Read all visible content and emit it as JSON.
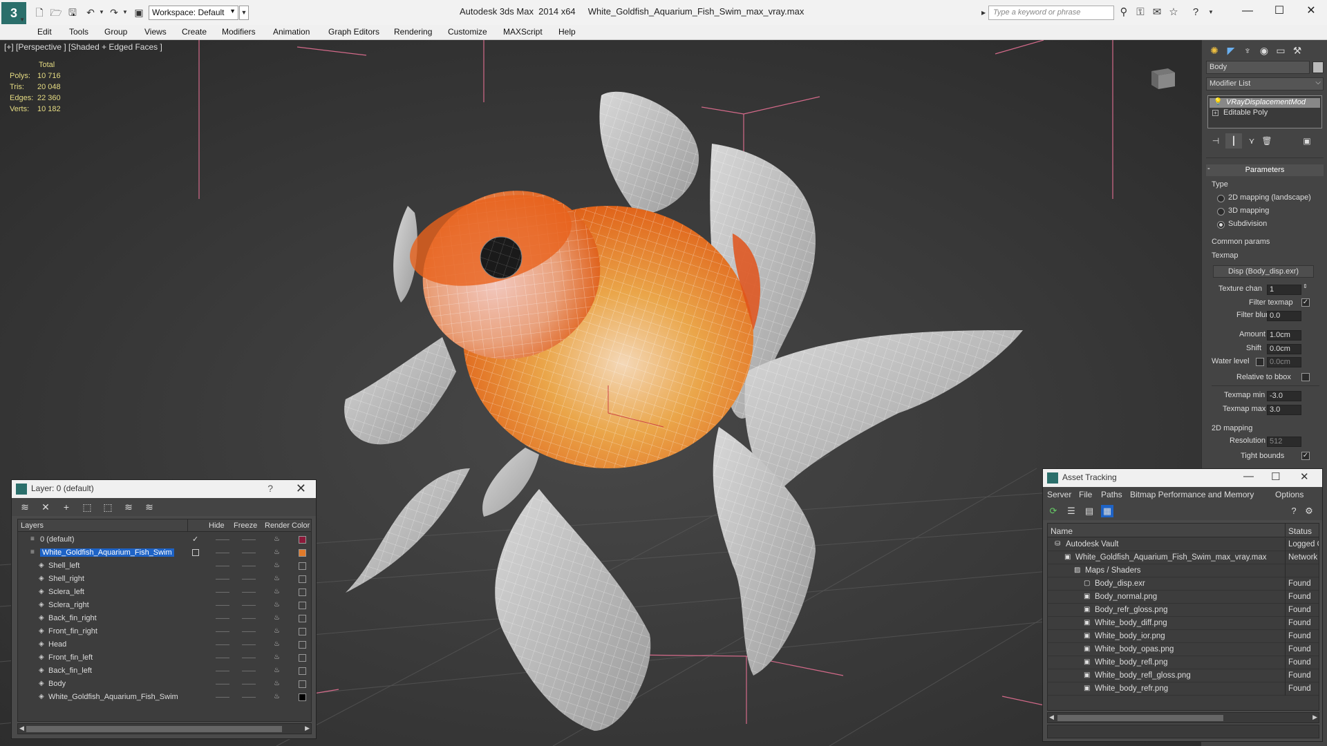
{
  "titlebar": {
    "app_title": "Autodesk 3ds Max  2014 x64",
    "file_title": "White_Goldfish_Aquarium_Fish_Swim_max_vray.max",
    "workspace": "Workspace: Default",
    "search_placeholder": "Type a keyword or phrase",
    "logo_letter": "3"
  },
  "menubar": {
    "items": [
      "Edit",
      "Tools",
      "Group",
      "Views",
      "Create",
      "Modifiers",
      "Animation",
      "Graph Editors",
      "Rendering",
      "Customize",
      "MAXScript",
      "Help"
    ]
  },
  "viewport": {
    "label": "[+] [Perspective ] [Shaded + Edged Faces ]",
    "stats_header": "Total",
    "stats": [
      {
        "key": "Polys:",
        "value": "10 716"
      },
      {
        "key": "Tris:",
        "value": "20 048"
      },
      {
        "key": "Edges:",
        "value": "22 360"
      },
      {
        "key": "Verts:",
        "value": "10 182"
      }
    ]
  },
  "command_panel": {
    "object_name": "Body",
    "modifier_list": "Modifier List",
    "stack": [
      "VRayDisplacementMod",
      "Editable Poly"
    ],
    "rollout_title": "Parameters",
    "type_label": "Type",
    "type_options": [
      "2D mapping (landscape)",
      "3D mapping",
      "Subdivision"
    ],
    "common_params": "Common params",
    "texmap_label": "Texmap",
    "texmap_button": "Disp (Body_disp.exr)",
    "texture_chan_label": "Texture chan",
    "texture_chan_value": "1",
    "filter_texmap_label": "Filter texmap",
    "filter_blur_label": "Filter blur",
    "filter_blur_value": "0.0",
    "amount_label": "Amount",
    "amount_value": "1.0cm",
    "shift_label": "Shift",
    "shift_value": "0.0cm",
    "water_level_label": "Water level",
    "water_level_value": "0.0cm",
    "relative_bbox_label": "Relative to bbox",
    "texmap_min_label": "Texmap min",
    "texmap_min_value": "-3.0",
    "texmap_max_label": "Texmap max",
    "texmap_max_value": "3.0",
    "mapping2d_label": "2D mapping",
    "resolution_label": "Resolution",
    "resolution_value": "512",
    "tight_bounds_label": "Tight bounds"
  },
  "layer_panel": {
    "title": "Layer: 0 (default)",
    "help": "?",
    "columns": [
      "Layers",
      "Hide",
      "Freeze",
      "Render",
      "Color"
    ],
    "rows": [
      {
        "name": "0 (default)",
        "level": 0,
        "color": "#8b1a3a",
        "check": true,
        "selected": false
      },
      {
        "name": "White_Goldfish_Aquarium_Fish_Swim",
        "level": 0,
        "color": "#e07a2a",
        "check": false,
        "selected": true
      },
      {
        "name": "Shell_left",
        "level": 1,
        "color": "#3d3d3d"
      },
      {
        "name": "Shell_right",
        "level": 1,
        "color": "#3d3d3d"
      },
      {
        "name": "Sclera_left",
        "level": 1,
        "color": "#3d3d3d"
      },
      {
        "name": "Sclera_right",
        "level": 1,
        "color": "#3d3d3d"
      },
      {
        "name": "Back_fin_right",
        "level": 1,
        "color": "#3d3d3d"
      },
      {
        "name": "Front_fin_right",
        "level": 1,
        "color": "#3d3d3d"
      },
      {
        "name": "Head",
        "level": 1,
        "color": "#3d3d3d"
      },
      {
        "name": "Front_fin_left",
        "level": 1,
        "color": "#3d3d3d"
      },
      {
        "name": "Back_fin_left",
        "level": 1,
        "color": "#3d3d3d"
      },
      {
        "name": "Body",
        "level": 1,
        "color": "#3d3d3d"
      },
      {
        "name": "White_Goldfish_Aquarium_Fish_Swim",
        "level": 1,
        "color": "#000000"
      }
    ]
  },
  "asset_panel": {
    "title": "Asset Tracking",
    "menu": [
      "Server",
      "File",
      "Paths",
      "Bitmap Performance and Memory",
      "Options"
    ],
    "columns": [
      "Name",
      "Status"
    ],
    "rows": [
      {
        "name": "Autodesk Vault",
        "status": "Logged O",
        "level": 0,
        "icon": "vault-icon"
      },
      {
        "name": "White_Goldfish_Aquarium_Fish_Swim_max_vray.max",
        "status": "Network",
        "level": 1,
        "icon": "max-file-icon"
      },
      {
        "name": "Maps / Shaders",
        "status": "",
        "level": 2,
        "icon": "maps-icon"
      },
      {
        "name": "Body_disp.exr",
        "status": "Found",
        "level": 3,
        "icon": "file-icon"
      },
      {
        "name": "Body_normal.png",
        "status": "Found",
        "level": 3,
        "icon": "image-icon"
      },
      {
        "name": "Body_refr_gloss.png",
        "status": "Found",
        "level": 3,
        "icon": "image-icon"
      },
      {
        "name": "White_body_diff.png",
        "status": "Found",
        "level": 3,
        "icon": "image-icon"
      },
      {
        "name": "White_body_ior.png",
        "status": "Found",
        "level": 3,
        "icon": "image-icon"
      },
      {
        "name": "White_body_opas.png",
        "status": "Found",
        "level": 3,
        "icon": "image-icon"
      },
      {
        "name": "White_body_refl.png",
        "status": "Found",
        "level": 3,
        "icon": "image-icon"
      },
      {
        "name": "White_body_refl_gloss.png",
        "status": "Found",
        "level": 3,
        "icon": "image-icon"
      },
      {
        "name": "White_body_refr.png",
        "status": "Found",
        "level": 3,
        "icon": "image-icon"
      }
    ]
  },
  "colors": {
    "accent": "#1e63c6",
    "stats_text": "#e6dc83",
    "viewport_bg": "#3b3b3b",
    "panel_bg": "#444444"
  }
}
